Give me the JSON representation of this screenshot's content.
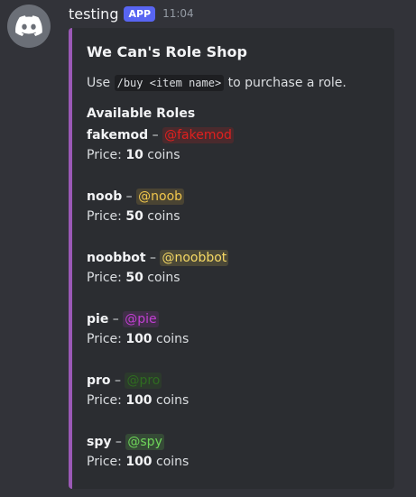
{
  "message": {
    "username": "testing",
    "badge": "APP",
    "timestamp": "11:04"
  },
  "embed": {
    "title": "We Can's Role Shop",
    "description_prefix": "Use",
    "command": "/buy <item name>",
    "description_suffix": "to purchase a role.",
    "field_name": "Available Roles",
    "accent_color": "#9b59b6",
    "price_label": "Price:",
    "coins_label": "coins",
    "roles": [
      {
        "name": "fakemod",
        "separator": "–",
        "mention": "@fakemod",
        "price": "10",
        "color": "#e0201f",
        "bg": "#4a2a2d"
      },
      {
        "name": "noob",
        "separator": "–",
        "mention": "@noob",
        "price": "50",
        "color": "#f0c64c",
        "bg": "#4a4433"
      },
      {
        "name": "noobbot",
        "separator": "–",
        "mention": "@noobbot",
        "price": "50",
        "color": "#f6d964",
        "bg": "#4b4837"
      },
      {
        "name": "pie",
        "separator": "–",
        "mention": "@pie",
        "price": "100",
        "color": "#c23fd3",
        "bg": "#402f48"
      },
      {
        "name": "pro",
        "separator": "–",
        "mention": "@pro",
        "price": "100",
        "color": "#2f6b21",
        "bg": "#2c3a2c"
      },
      {
        "name": "spy",
        "separator": "–",
        "mention": "@spy",
        "price": "100",
        "color": "#6fd65a",
        "bg": "#354a36"
      }
    ]
  }
}
